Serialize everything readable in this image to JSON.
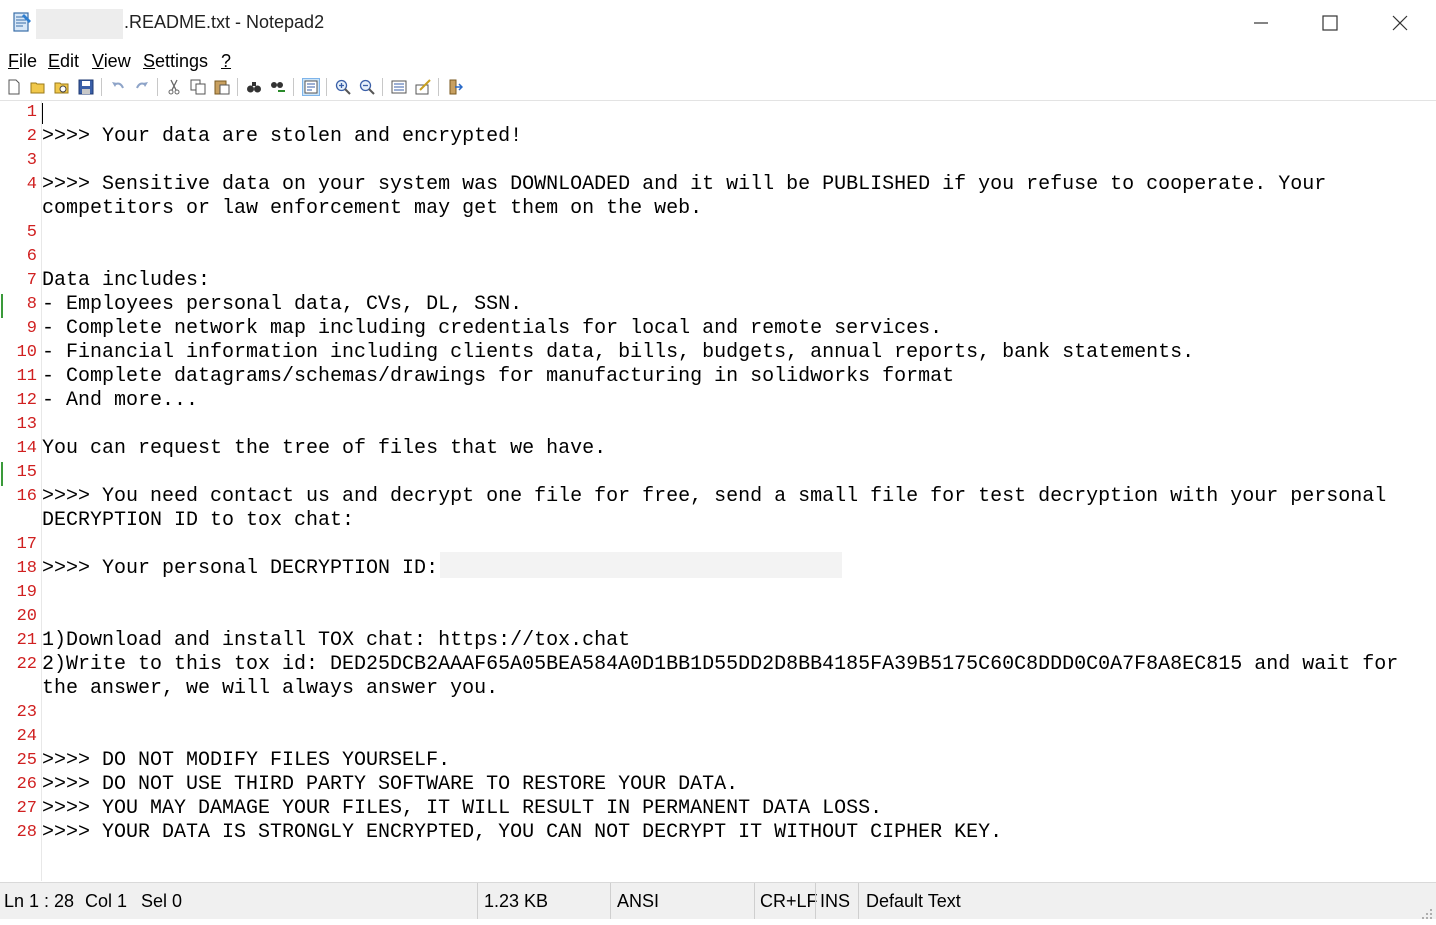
{
  "window": {
    "title": ".README.txt - Notepad2"
  },
  "menu": {
    "file": {
      "mnemonic": "F",
      "rest": "ile"
    },
    "edit": {
      "mnemonic": "E",
      "rest": "dit"
    },
    "view": {
      "mnemonic": "V",
      "rest": "iew"
    },
    "settings": {
      "mnemonic": "S",
      "rest": "ettings"
    },
    "help": {
      "mnemonic": "?",
      "rest": ""
    }
  },
  "toolbar_icons": [
    "new-icon",
    "open-icon",
    "browse-icon",
    "save-icon",
    "undo-icon",
    "redo-icon",
    "cut-icon",
    "copy-icon",
    "paste-icon",
    "find-icon",
    "replace-icon",
    "word-wrap-icon",
    "zoom-in-icon",
    "zoom-out-icon",
    "select-scheme-icon",
    "customize-scheme-icon",
    "exit-icon"
  ],
  "editor": {
    "gutter_numbers": [
      "1",
      "2",
      "3",
      "4",
      "5",
      "6",
      "7",
      "8",
      "9",
      "10",
      "11",
      "12",
      "13",
      "14",
      "15",
      "16",
      "17",
      "18",
      "19",
      "20",
      "21",
      "22",
      "23",
      "24",
      "25",
      "26",
      "27",
      "28"
    ],
    "lines": [
      "",
      ">>>> Your data are stolen and encrypted!",
      "",
      ">>>> Sensitive data on your system was DOWNLOADED and it will be PUBLISHED if you refuse to cooperate. Your",
      "competitors or law enforcement may get them on the web.",
      "",
      "",
      "Data includes:",
      "- Employees personal data, CVs, DL, SSN.",
      "- Complete network map including credentials for local and remote services.",
      "- Financial information including clients data, bills, budgets, annual reports, bank statements.",
      "- Complete datagrams/schemas/drawings for manufacturing in solidworks format",
      "- And more...",
      "",
      "You can request the tree of files that we have.",
      "",
      ">>>> You need contact us and decrypt one file for free, send a small file for test decryption with your personal",
      "DECRYPTION ID to tox chat:",
      "",
      ">>>> Your personal DECRYPTION ID:",
      "",
      "",
      "1)Download and install TOX chat: https://tox.chat",
      "2)Write to this tox id: DED25DCB2AAAF65A05BEA584A0D1BB1D55DD2D8BB4185FA39B5175C60C8DDD0C0A7F8A8EC815 and wait for",
      "the answer, we will always answer you.",
      "",
      "",
      ">>>> DO NOT MODIFY FILES YOURSELF.",
      ">>>> DO NOT USE THIRD PARTY SOFTWARE TO RESTORE YOUR DATA.",
      ">>>> YOU MAY DAMAGE YOUR FILES, IT WILL RESULT IN PERMANENT DATA LOSS.",
      ">>>> YOUR DATA IS STRONGLY ENCRYPTED, YOU CAN NOT DECRYPT IT WITHOUT CIPHER KEY."
    ]
  },
  "status": {
    "position": "Ln 1 : 28",
    "column": "Col 1",
    "selection": "Sel 0",
    "size": "1.23 KB",
    "encoding": "ANSI",
    "eol": "CR+LF",
    "mode": "INS",
    "scheme": "Default Text"
  },
  "colors": {
    "line_number": "#d02020",
    "change_marker": "#3a9a3a",
    "statusbar_bg": "#f0f0f0"
  }
}
